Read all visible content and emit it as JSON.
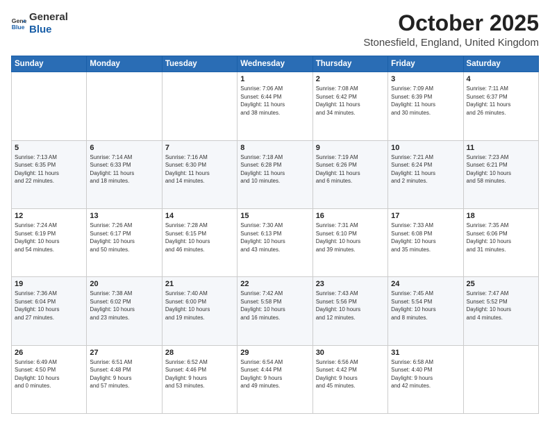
{
  "header": {
    "logo_line1": "General",
    "logo_line2": "Blue",
    "title": "October 2025",
    "subtitle": "Stonesfield, England, United Kingdom"
  },
  "calendar": {
    "days_of_week": [
      "Sunday",
      "Monday",
      "Tuesday",
      "Wednesday",
      "Thursday",
      "Friday",
      "Saturday"
    ],
    "weeks": [
      [
        {
          "day": "",
          "info": ""
        },
        {
          "day": "",
          "info": ""
        },
        {
          "day": "",
          "info": ""
        },
        {
          "day": "1",
          "info": "Sunrise: 7:06 AM\nSunset: 6:44 PM\nDaylight: 11 hours\nand 38 minutes."
        },
        {
          "day": "2",
          "info": "Sunrise: 7:08 AM\nSunset: 6:42 PM\nDaylight: 11 hours\nand 34 minutes."
        },
        {
          "day": "3",
          "info": "Sunrise: 7:09 AM\nSunset: 6:39 PM\nDaylight: 11 hours\nand 30 minutes."
        },
        {
          "day": "4",
          "info": "Sunrise: 7:11 AM\nSunset: 6:37 PM\nDaylight: 11 hours\nand 26 minutes."
        }
      ],
      [
        {
          "day": "5",
          "info": "Sunrise: 7:13 AM\nSunset: 6:35 PM\nDaylight: 11 hours\nand 22 minutes."
        },
        {
          "day": "6",
          "info": "Sunrise: 7:14 AM\nSunset: 6:33 PM\nDaylight: 11 hours\nand 18 minutes."
        },
        {
          "day": "7",
          "info": "Sunrise: 7:16 AM\nSunset: 6:30 PM\nDaylight: 11 hours\nand 14 minutes."
        },
        {
          "day": "8",
          "info": "Sunrise: 7:18 AM\nSunset: 6:28 PM\nDaylight: 11 hours\nand 10 minutes."
        },
        {
          "day": "9",
          "info": "Sunrise: 7:19 AM\nSunset: 6:26 PM\nDaylight: 11 hours\nand 6 minutes."
        },
        {
          "day": "10",
          "info": "Sunrise: 7:21 AM\nSunset: 6:24 PM\nDaylight: 11 hours\nand 2 minutes."
        },
        {
          "day": "11",
          "info": "Sunrise: 7:23 AM\nSunset: 6:21 PM\nDaylight: 10 hours\nand 58 minutes."
        }
      ],
      [
        {
          "day": "12",
          "info": "Sunrise: 7:24 AM\nSunset: 6:19 PM\nDaylight: 10 hours\nand 54 minutes."
        },
        {
          "day": "13",
          "info": "Sunrise: 7:26 AM\nSunset: 6:17 PM\nDaylight: 10 hours\nand 50 minutes."
        },
        {
          "day": "14",
          "info": "Sunrise: 7:28 AM\nSunset: 6:15 PM\nDaylight: 10 hours\nand 46 minutes."
        },
        {
          "day": "15",
          "info": "Sunrise: 7:30 AM\nSunset: 6:13 PM\nDaylight: 10 hours\nand 43 minutes."
        },
        {
          "day": "16",
          "info": "Sunrise: 7:31 AM\nSunset: 6:10 PM\nDaylight: 10 hours\nand 39 minutes."
        },
        {
          "day": "17",
          "info": "Sunrise: 7:33 AM\nSunset: 6:08 PM\nDaylight: 10 hours\nand 35 minutes."
        },
        {
          "day": "18",
          "info": "Sunrise: 7:35 AM\nSunset: 6:06 PM\nDaylight: 10 hours\nand 31 minutes."
        }
      ],
      [
        {
          "day": "19",
          "info": "Sunrise: 7:36 AM\nSunset: 6:04 PM\nDaylight: 10 hours\nand 27 minutes."
        },
        {
          "day": "20",
          "info": "Sunrise: 7:38 AM\nSunset: 6:02 PM\nDaylight: 10 hours\nand 23 minutes."
        },
        {
          "day": "21",
          "info": "Sunrise: 7:40 AM\nSunset: 6:00 PM\nDaylight: 10 hours\nand 19 minutes."
        },
        {
          "day": "22",
          "info": "Sunrise: 7:42 AM\nSunset: 5:58 PM\nDaylight: 10 hours\nand 16 minutes."
        },
        {
          "day": "23",
          "info": "Sunrise: 7:43 AM\nSunset: 5:56 PM\nDaylight: 10 hours\nand 12 minutes."
        },
        {
          "day": "24",
          "info": "Sunrise: 7:45 AM\nSunset: 5:54 PM\nDaylight: 10 hours\nand 8 minutes."
        },
        {
          "day": "25",
          "info": "Sunrise: 7:47 AM\nSunset: 5:52 PM\nDaylight: 10 hours\nand 4 minutes."
        }
      ],
      [
        {
          "day": "26",
          "info": "Sunrise: 6:49 AM\nSunset: 4:50 PM\nDaylight: 10 hours\nand 0 minutes."
        },
        {
          "day": "27",
          "info": "Sunrise: 6:51 AM\nSunset: 4:48 PM\nDaylight: 9 hours\nand 57 minutes."
        },
        {
          "day": "28",
          "info": "Sunrise: 6:52 AM\nSunset: 4:46 PM\nDaylight: 9 hours\nand 53 minutes."
        },
        {
          "day": "29",
          "info": "Sunrise: 6:54 AM\nSunset: 4:44 PM\nDaylight: 9 hours\nand 49 minutes."
        },
        {
          "day": "30",
          "info": "Sunrise: 6:56 AM\nSunset: 4:42 PM\nDaylight: 9 hours\nand 45 minutes."
        },
        {
          "day": "31",
          "info": "Sunrise: 6:58 AM\nSunset: 4:40 PM\nDaylight: 9 hours\nand 42 minutes."
        },
        {
          "day": "",
          "info": ""
        }
      ]
    ]
  }
}
